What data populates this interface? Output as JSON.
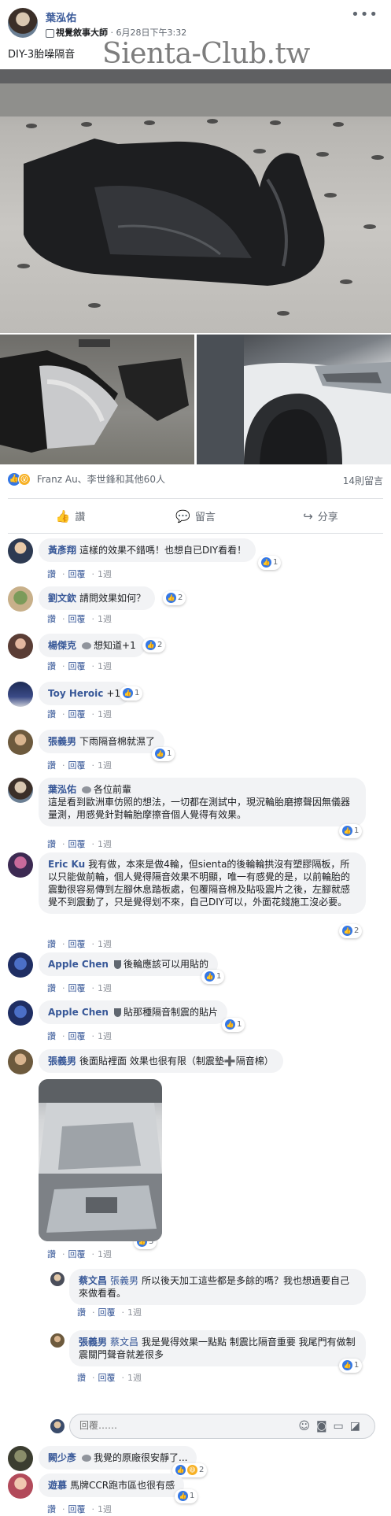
{
  "post": {
    "author": "葉泓佑",
    "group_badge": "視覺敘事大師",
    "time": "6月28日下午3:32",
    "title": "DIY-3胎噪隔音",
    "watermark": "Sienta-Club.tw",
    "reactions_text": "Franz Au、李世鋒和其他60人",
    "comments_count": "14則留言"
  },
  "actions": {
    "like": "讚",
    "comment": "留言",
    "share": "分享"
  },
  "labels": {
    "like": "讚",
    "reply": "回覆",
    "sep": "·"
  },
  "comments": [
    {
      "name": "黃彥翔",
      "text": "這樣的效果不錯嗎！也想自已DIY看看！",
      "likes": "1",
      "time": "1週"
    },
    {
      "name": "劉文欽",
      "text": "請問效果如何？",
      "likes": "2",
      "time": "1週"
    },
    {
      "name": "楊傑克",
      "text": "想知道+1",
      "likes": "2",
      "time": "1週"
    },
    {
      "name": "Toy Heroic",
      "text": "+1",
      "likes": "1",
      "time": "1週"
    },
    {
      "name": "張義男",
      "text": "下雨隔音棉就濕了",
      "likes": "1",
      "time": "1週"
    },
    {
      "name": "葉泓佑",
      "text": "各位前輩",
      "text2": "這是看到歐洲車仿照的想法，一切都在測試中，現況輪胎磨擦聲因無儀器量測，用感覺針對輪胎摩擦音個人覺得有效果。",
      "likes": "1",
      "time": "1週"
    },
    {
      "name": "Eric Ku",
      "text": "我有做，本來是做4輪，但sienta的後輪輪拱沒有塑膠隔板，所以只能做前輪，個人覺得隔音效果不明顯，唯一有感覺的是，以前輪胎的震動很容易傳到左腳休息踏板處，包覆隔音棉及貼吸震片之後，左腳就感覺不到震動了，只是覺得划不來，自己DIY可以，外面花錢施工沒必要。",
      "likes": "2",
      "time": "1週"
    },
    {
      "name": "Apple Chen",
      "text": "後輪應該可以用貼的",
      "likes": "1",
      "time": "1週"
    },
    {
      "name": "Apple Chen",
      "text": "貼那種隔音制震的貼片",
      "likes": "1",
      "time": "1週"
    },
    {
      "name": "張義男",
      "text": "後面貼裡面 效果也很有限（制震墊➕隔音棉）",
      "likes": "3",
      "time": "1週"
    },
    {
      "name": "蔡文昌",
      "mention": "張義男",
      "text": "所以後天加工這些都是多餘的嗎？我也想過要自己來做看看。",
      "time": "1週"
    },
    {
      "name": "張義男",
      "mention": "蔡文昌",
      "text": "我是覺得效果一點點 制震比隔音重要 我尾門有做制震關門聲音就差很多",
      "likes": "1",
      "time": "1週"
    },
    {
      "name": "闕少彥",
      "text": "我覺的原廠很安靜了...",
      "likes": "2",
      "time": "1週"
    },
    {
      "name": "遊慕",
      "text": "馬牌CCR跑市區也很有感",
      "likes": "1",
      "time": "1週"
    }
  ],
  "reply_box": {
    "placeholder": "回覆……"
  },
  "colors": {
    "link": "#385898",
    "like_blue": "#3578e5",
    "bubble": "#f2f3f5"
  }
}
